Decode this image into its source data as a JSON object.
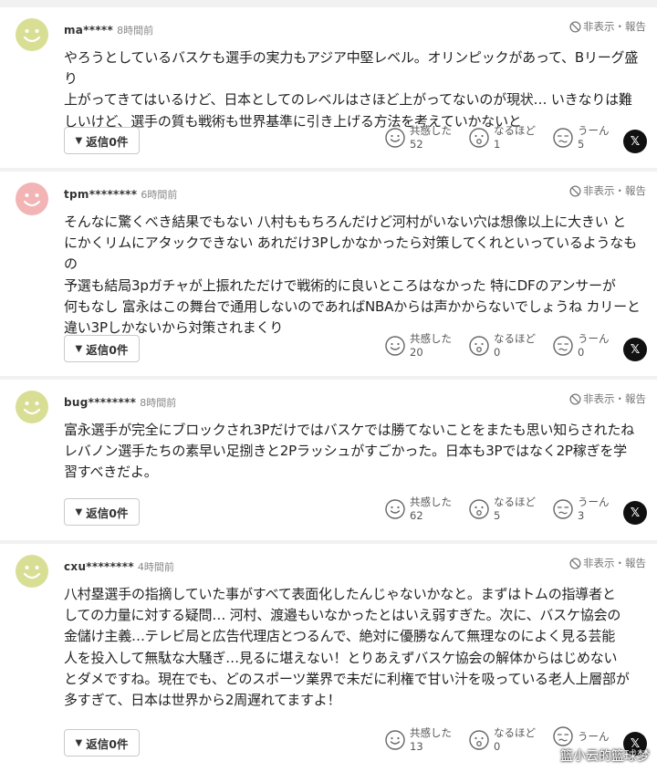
{
  "ui": {
    "hide_report": "非表示・報告",
    "reply_label": "返信0件",
    "reaction_empathy": "共感した",
    "reaction_convinced": "なるほど",
    "reaction_hmm": "うーん",
    "x_label": "𝕏"
  },
  "comments": [
    {
      "user": "ma*****",
      "time": "8時間前",
      "avatar_color": "#d8df95",
      "lines": [
        "やろうとしているバスケも選手の実力もアジア中堅レベル。オリンピックがあって、Bリーグ盛り",
        "上がってきてはいるけど、日本としてのレベルはさほど上がってないのが現状… いきなりは難",
        "しいけど、選手の質も戦術も世界基準に引き上げる方法を考えていかないと"
      ],
      "empathy": "52",
      "convinced": "1",
      "hmm": "5"
    },
    {
      "user": "tpm********",
      "time": "6時間前",
      "avatar_color": "#f2b4b4",
      "lines": [
        "そんなに驚くべき結果でもない 八村ももちろんだけど河村がいない穴は想像以上に大きい と",
        "にかくリムにアタックできない あれだけ3Pしかなかったら対策してくれといっているようなもの",
        "予選も結局3pガチャが上振れただけで戦術的に良いところはなかった 特にDFのアンサーが",
        "何もなし 富永はこの舞台で通用しないのであればNBAからは声かからないでしょうね カリーと",
        "違い3Pしかないから対策されまくり"
      ],
      "empathy": "20",
      "convinced": "0",
      "hmm": "0"
    },
    {
      "user": "bug********",
      "time": "8時間前",
      "avatar_color": "#d8df95",
      "lines": [
        "富永選手が完全にブロックされ3Pだけではバスケでは勝てないことをまたも思い知らされたね",
        "レバノン選手たちの素早い足捌きと2Pラッシュがすごかった。日本も3Pではなく2P稼ぎを学",
        "習すべきだよ。"
      ],
      "empathy": "62",
      "convinced": "5",
      "hmm": "3"
    },
    {
      "user": "cxu********",
      "time": "4時間前",
      "avatar_color": "#d8df95",
      "lines": [
        "八村塁選手の指摘していた事がすべて表面化したんじゃないかなと。まずはトムの指導者と",
        "しての力量に対する疑問… 河村、渡邉もいなかったとはいえ弱すぎた。次に、バスケ協会の",
        "金儲け主義…テレビ局と広告代理店とつるんで、絶対に優勝なんて無理なのによく見る芸能",
        "人を投入して無駄な大騒ぎ…見るに堪えない！とりあえずバスケ協会の解体からはじめない",
        "とダメですね。現在でも、どのスポーツ業界で未だに利権で甘い汁を吸っている老人上層部が",
        "多すぎて、日本は世界から2周遅れてますよ！"
      ],
      "empathy": "13",
      "convinced": "0",
      "hmm": ""
    }
  ],
  "watermark": "篮小云的篮球梦"
}
